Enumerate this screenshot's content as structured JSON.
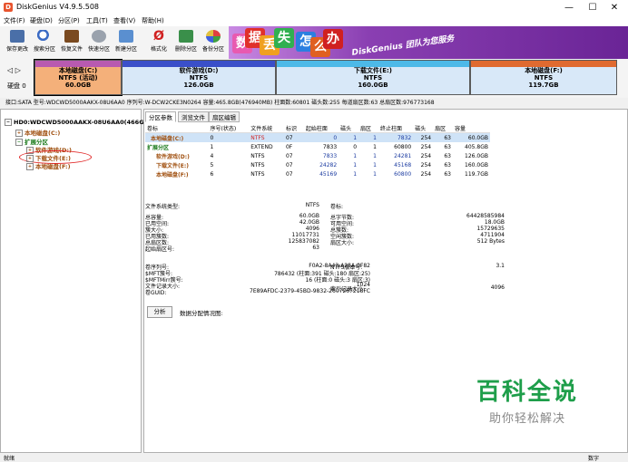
{
  "window": {
    "title": "DiskGenius V4.9.5.508",
    "min": "—",
    "max": "☐",
    "close": "✕"
  },
  "menu": [
    "文件(F)",
    "硬盘(D)",
    "分区(P)",
    "工具(T)",
    "查看(V)",
    "帮助(H)"
  ],
  "toolbar": [
    "保存更改",
    "搜索分区",
    "恢复文件",
    "快速分区",
    "新建分区",
    "格式化",
    "删除分区",
    "备份分区"
  ],
  "banner": {
    "chars": [
      "数",
      "据",
      "丢",
      "失",
      "怎",
      "么",
      "办"
    ],
    "text": "DiskGenius 团队为您服务"
  },
  "disk": {
    "nav": "◁ ▷",
    "label": "硬盘 0",
    "partitions": [
      {
        "name": "本地磁盘(C:)",
        "fs": "NTFS (活动)",
        "size": "60.0GB",
        "color": "#b85ab0"
      },
      {
        "name": "软件游戏(D:)",
        "fs": "NTFS",
        "size": "126.0GB",
        "color": "#3a4fc9"
      },
      {
        "name": "下载文件(E:)",
        "fs": "NTFS",
        "size": "160.0GB",
        "color": "#4db9e8"
      },
      {
        "name": "本地磁盘(F:)",
        "fs": "NTFS",
        "size": "119.7GB",
        "color": "#e06a30"
      }
    ],
    "info": "接口:SATA  型号:WDCWD5000AAKX-08U6AA0  序列号:W-DCW2CKE3N0264  容量:465.8GB(476940MB)  柱面数:60801  磁头数:255  每道扇区数:63  总扇区数:976773168"
  },
  "tree": {
    "disk": "HD0:WDCWD5000AAKX-08U6AA0(466GB)",
    "c": "本地磁盘(C:)",
    "ext": "扩展分区",
    "d": "软件游戏(D:)",
    "e": "下载文件(E:)",
    "f": "本地磁盘(F:)"
  },
  "tabs": [
    "分区参数",
    "浏览文件",
    "扇区编辑"
  ],
  "table": {
    "headers": [
      "卷标",
      "序号(状态)",
      "文件系统",
      "标识",
      "起始柱面",
      "磁头",
      "扇区",
      "终止柱面",
      "磁头",
      "扇区",
      "容量"
    ],
    "rows": [
      [
        "本地磁盘(C:)",
        "0",
        "NTFS",
        "07",
        "0",
        "1",
        "1",
        "7832",
        "254",
        "63",
        "60.0GB"
      ],
      [
        "扩展分区",
        "1",
        "EXTEND",
        "0F",
        "7833",
        "0",
        "1",
        "60800",
        "254",
        "63",
        "405.8GB"
      ],
      [
        "软件游戏(D:)",
        "4",
        "NTFS",
        "07",
        "7833",
        "1",
        "1",
        "24281",
        "254",
        "63",
        "126.0GB"
      ],
      [
        "下载文件(E:)",
        "5",
        "NTFS",
        "07",
        "24282",
        "1",
        "1",
        "45168",
        "254",
        "63",
        "160.0GB"
      ],
      [
        "本地磁盘(F:)",
        "6",
        "NTFS",
        "07",
        "45169",
        "1",
        "1",
        "60800",
        "254",
        "63",
        "119.7GB"
      ]
    ]
  },
  "details": {
    "fs_type_k": "文件系统类型:",
    "fs_type_v": "NTFS",
    "vol_k": "卷标:",
    "left": [
      [
        "总容量:",
        "60.0GB"
      ],
      [
        "已用空间:",
        "42.0GB"
      ],
      [
        "簇大小:",
        "4096"
      ],
      [
        "已用簇数:",
        "11017731"
      ],
      [
        "总扇区数:",
        "125837082"
      ],
      [
        "起始扇区号:",
        "63"
      ]
    ],
    "right": [
      [
        "总字节数:",
        "64428585984"
      ],
      [
        "可用空间:",
        "18.0GB"
      ],
      [
        "总簇数:",
        "15729635"
      ],
      [
        "空闲簇数:",
        "4711904"
      ],
      [
        "扇区大小:",
        "512 Bytes"
      ]
    ],
    "lower_left": [
      [
        "卷序列号:",
        "F0A2-8A43-A28A-0F82"
      ],
      [
        "$MFT簇号:",
        "786432 (柱面:391 磁头:180 扇区:25)"
      ],
      [
        "$MFTMirr簇号:",
        "16 (柱面:0 磁头:3 扇区:3)"
      ],
      [
        "文件记录大小:",
        "1024"
      ],
      [
        "卷GUID:",
        "7E89AFDC-2379-45BD-9832-2607267218FC"
      ]
    ],
    "ntfs_ver_k": "NTFS版本号:",
    "ntfs_ver_v": "3.1",
    "index_k": "索引记录大小:",
    "index_v": "4096",
    "analyze": "分析",
    "analyze_label": "数据分配情况图:"
  },
  "status": {
    "left": "就绪",
    "right": "数字"
  },
  "watermark": {
    "title": "百科全说",
    "subtitle": "助你轻松解决"
  }
}
